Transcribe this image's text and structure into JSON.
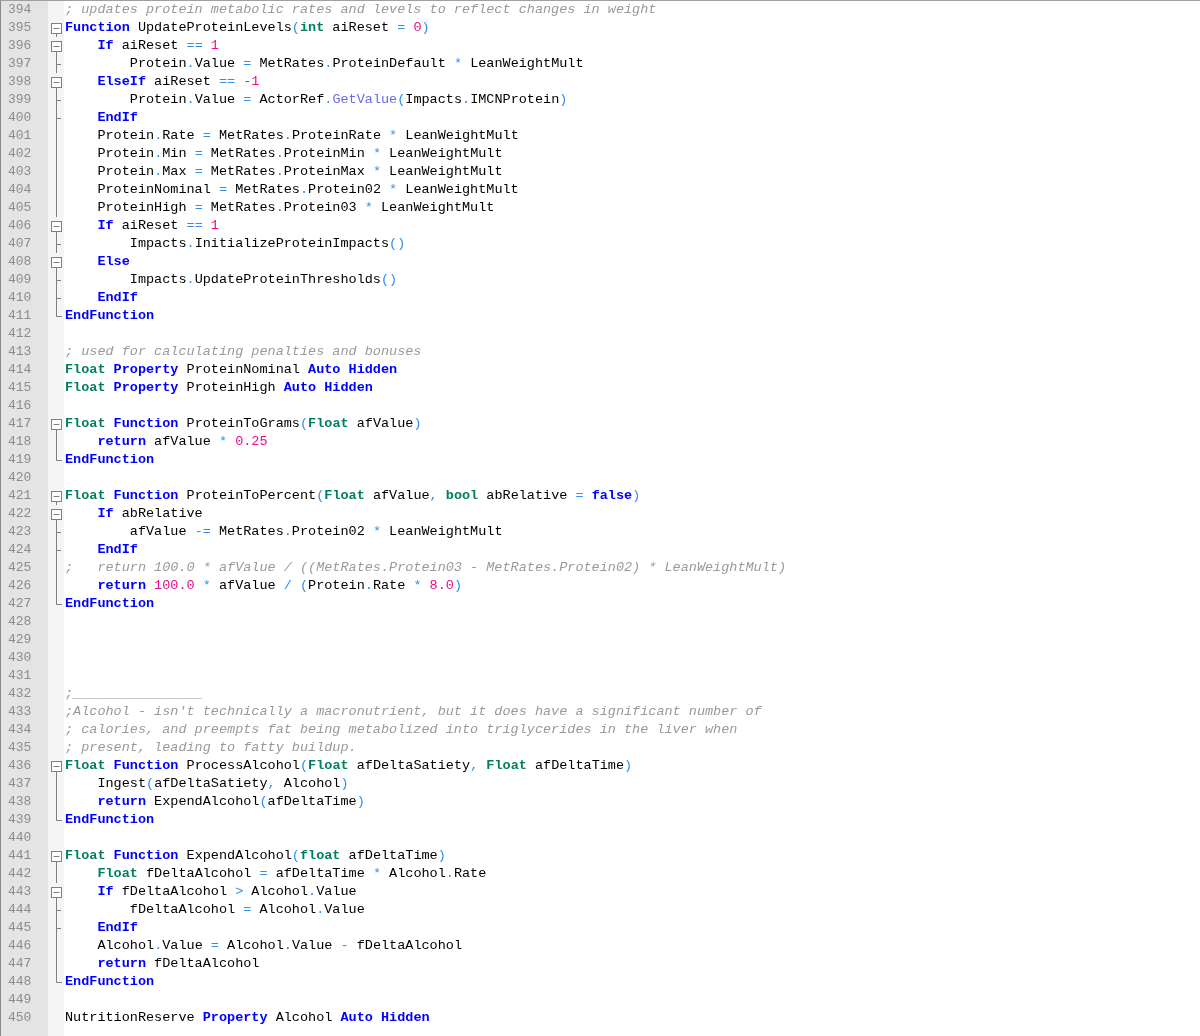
{
  "editor": {
    "lines": [
      {
        "number": "394",
        "kind": "none",
        "tokens": [
          {
            "kind": "c",
            "text": "; updates protein metabolic rates and levels to reflect changes in weight"
          }
        ]
      },
      {
        "number": "395",
        "kind": "open",
        "tokens": [
          {
            "kind": "k",
            "text": "Function"
          },
          {
            "kind": "p",
            "text": " UpdateProteinLevels"
          },
          {
            "kind": "o",
            "text": "("
          },
          {
            "kind": "t",
            "text": "int"
          },
          {
            "kind": "p",
            "text": " aiReset "
          },
          {
            "kind": "o",
            "text": "="
          },
          {
            "kind": "n",
            "text": " 0"
          },
          {
            "kind": "o",
            "text": ")"
          }
        ]
      },
      {
        "number": "396",
        "kind": "open",
        "tokens": [
          {
            "kind": "k",
            "text": "    If"
          },
          {
            "kind": "p",
            "text": " aiReset "
          },
          {
            "kind": "o",
            "text": "=="
          },
          {
            "kind": "n",
            "text": " 1"
          }
        ]
      },
      {
        "number": "397",
        "kind": "branch",
        "tokens": [
          {
            "kind": "p",
            "text": "        Protein"
          },
          {
            "kind": "o",
            "text": "."
          },
          {
            "kind": "p",
            "text": "Value "
          },
          {
            "kind": "o",
            "text": "="
          },
          {
            "kind": "p",
            "text": " MetRates"
          },
          {
            "kind": "o",
            "text": "."
          },
          {
            "kind": "p",
            "text": "ProteinDefault "
          },
          {
            "kind": "o",
            "text": "*"
          },
          {
            "kind": "p",
            "text": " LeanWeightMult"
          }
        ]
      },
      {
        "number": "398",
        "kind": "open",
        "tokens": [
          {
            "kind": "k",
            "text": "    ElseIf"
          },
          {
            "kind": "p",
            "text": " aiReset "
          },
          {
            "kind": "o",
            "text": "=="
          },
          {
            "kind": "n",
            "text": " -1"
          }
        ]
      },
      {
        "number": "399",
        "kind": "branch",
        "tokens": [
          {
            "kind": "p",
            "text": "        Protein"
          },
          {
            "kind": "o",
            "text": "."
          },
          {
            "kind": "p",
            "text": "Value "
          },
          {
            "kind": "o",
            "text": "="
          },
          {
            "kind": "p",
            "text": " ActorRef"
          },
          {
            "kind": "o",
            "text": "."
          },
          {
            "kind": "f",
            "text": "GetValue"
          },
          {
            "kind": "o",
            "text": "("
          },
          {
            "kind": "p",
            "text": "Impacts"
          },
          {
            "kind": "o",
            "text": "."
          },
          {
            "kind": "p",
            "text": "IMCNProtein"
          },
          {
            "kind": "o",
            "text": ")"
          }
        ]
      },
      {
        "number": "400",
        "kind": "branch",
        "tokens": [
          {
            "kind": "k",
            "text": "    EndIf"
          }
        ]
      },
      {
        "number": "401",
        "kind": "line",
        "tokens": [
          {
            "kind": "p",
            "text": "    Protein"
          },
          {
            "kind": "o",
            "text": "."
          },
          {
            "kind": "p",
            "text": "Rate "
          },
          {
            "kind": "o",
            "text": "="
          },
          {
            "kind": "p",
            "text": " MetRates"
          },
          {
            "kind": "o",
            "text": "."
          },
          {
            "kind": "p",
            "text": "ProteinRate "
          },
          {
            "kind": "o",
            "text": "*"
          },
          {
            "kind": "p",
            "text": " LeanWeightMult"
          }
        ]
      },
      {
        "number": "402",
        "kind": "line",
        "tokens": [
          {
            "kind": "p",
            "text": "    Protein"
          },
          {
            "kind": "o",
            "text": "."
          },
          {
            "kind": "p",
            "text": "Min "
          },
          {
            "kind": "o",
            "text": "="
          },
          {
            "kind": "p",
            "text": " MetRates"
          },
          {
            "kind": "o",
            "text": "."
          },
          {
            "kind": "p",
            "text": "ProteinMin "
          },
          {
            "kind": "o",
            "text": "*"
          },
          {
            "kind": "p",
            "text": " LeanWeightMult"
          }
        ]
      },
      {
        "number": "403",
        "kind": "line",
        "tokens": [
          {
            "kind": "p",
            "text": "    Protein"
          },
          {
            "kind": "o",
            "text": "."
          },
          {
            "kind": "p",
            "text": "Max "
          },
          {
            "kind": "o",
            "text": "="
          },
          {
            "kind": "p",
            "text": " MetRates"
          },
          {
            "kind": "o",
            "text": "."
          },
          {
            "kind": "p",
            "text": "ProteinMax "
          },
          {
            "kind": "o",
            "text": "*"
          },
          {
            "kind": "p",
            "text": " LeanWeightMult"
          }
        ]
      },
      {
        "number": "404",
        "kind": "line",
        "tokens": [
          {
            "kind": "p",
            "text": "    ProteinNominal "
          },
          {
            "kind": "o",
            "text": "="
          },
          {
            "kind": "p",
            "text": " MetRates"
          },
          {
            "kind": "o",
            "text": "."
          },
          {
            "kind": "p",
            "text": "Protein02 "
          },
          {
            "kind": "o",
            "text": "*"
          },
          {
            "kind": "p",
            "text": " LeanWeightMult"
          }
        ]
      },
      {
        "number": "405",
        "kind": "line",
        "tokens": [
          {
            "kind": "p",
            "text": "    ProteinHigh "
          },
          {
            "kind": "o",
            "text": "="
          },
          {
            "kind": "p",
            "text": " MetRates"
          },
          {
            "kind": "o",
            "text": "."
          },
          {
            "kind": "p",
            "text": "Protein03 "
          },
          {
            "kind": "o",
            "text": "*"
          },
          {
            "kind": "p",
            "text": " LeanWeightMult"
          }
        ]
      },
      {
        "number": "406",
        "kind": "open",
        "tokens": [
          {
            "kind": "k",
            "text": "    If"
          },
          {
            "kind": "p",
            "text": " aiReset "
          },
          {
            "kind": "o",
            "text": "=="
          },
          {
            "kind": "n",
            "text": " 1"
          }
        ]
      },
      {
        "number": "407",
        "kind": "branch",
        "tokens": [
          {
            "kind": "p",
            "text": "        Impacts"
          },
          {
            "kind": "o",
            "text": "."
          },
          {
            "kind": "p",
            "text": "InitializeProteinImpacts"
          },
          {
            "kind": "o",
            "text": "()"
          }
        ]
      },
      {
        "number": "408",
        "kind": "open",
        "tokens": [
          {
            "kind": "k",
            "text": "    Else"
          }
        ]
      },
      {
        "number": "409",
        "kind": "branch",
        "tokens": [
          {
            "kind": "p",
            "text": "        Impacts"
          },
          {
            "kind": "o",
            "text": "."
          },
          {
            "kind": "p",
            "text": "UpdateProteinThresholds"
          },
          {
            "kind": "o",
            "text": "()"
          }
        ]
      },
      {
        "number": "410",
        "kind": "branch",
        "tokens": [
          {
            "kind": "k",
            "text": "    EndIf"
          }
        ]
      },
      {
        "number": "411",
        "kind": "end",
        "tokens": [
          {
            "kind": "k",
            "text": "EndFunction"
          }
        ]
      },
      {
        "number": "412",
        "kind": "none"
      },
      {
        "number": "413",
        "kind": "none",
        "tokens": [
          {
            "kind": "c",
            "text": "; used for calculating penalties and bonuses"
          }
        ]
      },
      {
        "number": "414",
        "kind": "none",
        "tokens": [
          {
            "kind": "t",
            "text": "Float"
          },
          {
            "kind": "k",
            "text": " Property"
          },
          {
            "kind": "p",
            "text": " ProteinNominal "
          },
          {
            "kind": "k",
            "text": "Auto"
          },
          {
            "kind": "k",
            "text": " Hidden"
          }
        ]
      },
      {
        "number": "415",
        "kind": "none",
        "tokens": [
          {
            "kind": "t",
            "text": "Float"
          },
          {
            "kind": "k",
            "text": " Property"
          },
          {
            "kind": "p",
            "text": " ProteinHigh "
          },
          {
            "kind": "k",
            "text": "Auto"
          },
          {
            "kind": "k",
            "text": " Hidden"
          }
        ]
      },
      {
        "number": "416",
        "kind": "none"
      },
      {
        "number": "417",
        "kind": "open",
        "tokens": [
          {
            "kind": "t",
            "text": "Float"
          },
          {
            "kind": "k",
            "text": " Function"
          },
          {
            "kind": "p",
            "text": " ProteinToGrams"
          },
          {
            "kind": "o",
            "text": "("
          },
          {
            "kind": "t",
            "text": "Float"
          },
          {
            "kind": "p",
            "text": " afValue"
          },
          {
            "kind": "o",
            "text": ")"
          }
        ]
      },
      {
        "number": "418",
        "kind": "line",
        "tokens": [
          {
            "kind": "k",
            "text": "    return"
          },
          {
            "kind": "p",
            "text": " afValue "
          },
          {
            "kind": "o",
            "text": "*"
          },
          {
            "kind": "n",
            "text": " 0.25"
          }
        ]
      },
      {
        "number": "419",
        "kind": "end",
        "tokens": [
          {
            "kind": "k",
            "text": "EndFunction"
          }
        ]
      },
      {
        "number": "420",
        "kind": "none"
      },
      {
        "number": "421",
        "kind": "open",
        "tokens": [
          {
            "kind": "t",
            "text": "Float"
          },
          {
            "kind": "k",
            "text": " Function"
          },
          {
            "kind": "p",
            "text": " ProteinToPercent"
          },
          {
            "kind": "o",
            "text": "("
          },
          {
            "kind": "t",
            "text": "Float"
          },
          {
            "kind": "p",
            "text": " afValue"
          },
          {
            "kind": "o",
            "text": ","
          },
          {
            "kind": "t",
            "text": " bool"
          },
          {
            "kind": "p",
            "text": " abRelative "
          },
          {
            "kind": "o",
            "text": "="
          },
          {
            "kind": "k",
            "text": " false"
          },
          {
            "kind": "o",
            "text": ")"
          }
        ]
      },
      {
        "number": "422",
        "kind": "open",
        "tokens": [
          {
            "kind": "k",
            "text": "    If"
          },
          {
            "kind": "p",
            "text": " abRelative"
          }
        ]
      },
      {
        "number": "423",
        "kind": "branch",
        "tokens": [
          {
            "kind": "p",
            "text": "        afValue "
          },
          {
            "kind": "o",
            "text": "-="
          },
          {
            "kind": "p",
            "text": " MetRates"
          },
          {
            "kind": "o",
            "text": "."
          },
          {
            "kind": "p",
            "text": "Protein02 "
          },
          {
            "kind": "o",
            "text": "*"
          },
          {
            "kind": "p",
            "text": " LeanWeightMult"
          }
        ]
      },
      {
        "number": "424",
        "kind": "branch",
        "tokens": [
          {
            "kind": "k",
            "text": "    EndIf"
          }
        ]
      },
      {
        "number": "425",
        "kind": "line",
        "tokens": [
          {
            "kind": "c",
            "text": ";   return 100.0 * afValue / ((MetRates.Protein03 - MetRates.Protein02) * LeanWeightMult)"
          }
        ]
      },
      {
        "number": "426",
        "kind": "line",
        "tokens": [
          {
            "kind": "k",
            "text": "    return"
          },
          {
            "kind": "n",
            "text": " 100.0"
          },
          {
            "kind": "o",
            "text": " *"
          },
          {
            "kind": "p",
            "text": " afValue "
          },
          {
            "kind": "o",
            "text": "/ ("
          },
          {
            "kind": "p",
            "text": "Protein"
          },
          {
            "kind": "o",
            "text": "."
          },
          {
            "kind": "p",
            "text": "Rate "
          },
          {
            "kind": "o",
            "text": "*"
          },
          {
            "kind": "n",
            "text": " 8.0"
          },
          {
            "kind": "o",
            "text": ")"
          }
        ]
      },
      {
        "number": "427",
        "kind": "end",
        "tokens": [
          {
            "kind": "k",
            "text": "EndFunction"
          }
        ]
      },
      {
        "number": "428",
        "kind": "none"
      },
      {
        "number": "429",
        "kind": "none"
      },
      {
        "number": "430",
        "kind": "none"
      },
      {
        "number": "431",
        "kind": "none"
      },
      {
        "number": "432",
        "kind": "none",
        "tokens": [
          {
            "kind": "c",
            "text": ";________________"
          }
        ]
      },
      {
        "number": "433",
        "kind": "none",
        "tokens": [
          {
            "kind": "c",
            "text": ";Alcohol - isn't technically a macronutrient, but it does have a significant number of"
          }
        ]
      },
      {
        "number": "434",
        "kind": "none",
        "tokens": [
          {
            "kind": "c",
            "text": "; calories, and preempts fat being metabolized into triglycerides in the liver when"
          }
        ]
      },
      {
        "number": "435",
        "kind": "none",
        "tokens": [
          {
            "kind": "c",
            "text": "; present, leading to fatty buildup."
          }
        ]
      },
      {
        "number": "436",
        "kind": "open",
        "tokens": [
          {
            "kind": "t",
            "text": "Float"
          },
          {
            "kind": "k",
            "text": " Function"
          },
          {
            "kind": "p",
            "text": " ProcessAlcohol"
          },
          {
            "kind": "o",
            "text": "("
          },
          {
            "kind": "t",
            "text": "Float"
          },
          {
            "kind": "p",
            "text": " afDeltaSatiety"
          },
          {
            "kind": "o",
            "text": ","
          },
          {
            "kind": "t",
            "text": " Float"
          },
          {
            "kind": "p",
            "text": " afDeltaTime"
          },
          {
            "kind": "o",
            "text": ")"
          }
        ]
      },
      {
        "number": "437",
        "kind": "line",
        "tokens": [
          {
            "kind": "p",
            "text": "    Ingest"
          },
          {
            "kind": "o",
            "text": "("
          },
          {
            "kind": "p",
            "text": "afDeltaSatiety"
          },
          {
            "kind": "o",
            "text": ","
          },
          {
            "kind": "p",
            "text": " Alcohol"
          },
          {
            "kind": "o",
            "text": ")"
          }
        ]
      },
      {
        "number": "438",
        "kind": "line",
        "tokens": [
          {
            "kind": "k",
            "text": "    return"
          },
          {
            "kind": "p",
            "text": " ExpendAlcohol"
          },
          {
            "kind": "o",
            "text": "("
          },
          {
            "kind": "p",
            "text": "afDeltaTime"
          },
          {
            "kind": "o",
            "text": ")"
          }
        ]
      },
      {
        "number": "439",
        "kind": "end",
        "tokens": [
          {
            "kind": "k",
            "text": "EndFunction"
          }
        ]
      },
      {
        "number": "440",
        "kind": "none"
      },
      {
        "number": "441",
        "kind": "open",
        "tokens": [
          {
            "kind": "t",
            "text": "Float"
          },
          {
            "kind": "k",
            "text": " Function"
          },
          {
            "kind": "p",
            "text": " ExpendAlcohol"
          },
          {
            "kind": "o",
            "text": "("
          },
          {
            "kind": "t",
            "text": "float"
          },
          {
            "kind": "p",
            "text": " afDeltaTime"
          },
          {
            "kind": "o",
            "text": ")"
          }
        ]
      },
      {
        "number": "442",
        "kind": "line",
        "tokens": [
          {
            "kind": "t",
            "text": "    Float"
          },
          {
            "kind": "p",
            "text": " fDeltaAlcohol "
          },
          {
            "kind": "o",
            "text": "="
          },
          {
            "kind": "p",
            "text": " afDeltaTime "
          },
          {
            "kind": "o",
            "text": "*"
          },
          {
            "kind": "p",
            "text": " Alcohol"
          },
          {
            "kind": "o",
            "text": "."
          },
          {
            "kind": "p",
            "text": "Rate"
          }
        ]
      },
      {
        "number": "443",
        "kind": "open",
        "tokens": [
          {
            "kind": "k",
            "text": "    If"
          },
          {
            "kind": "p",
            "text": " fDeltaAlcohol "
          },
          {
            "kind": "o",
            "text": ">"
          },
          {
            "kind": "p",
            "text": " Alcohol"
          },
          {
            "kind": "o",
            "text": "."
          },
          {
            "kind": "p",
            "text": "Value"
          }
        ]
      },
      {
        "number": "444",
        "kind": "branch",
        "tokens": [
          {
            "kind": "p",
            "text": "        fDeltaAlcohol "
          },
          {
            "kind": "o",
            "text": "="
          },
          {
            "kind": "p",
            "text": " Alcohol"
          },
          {
            "kind": "o",
            "text": "."
          },
          {
            "kind": "p",
            "text": "Value"
          }
        ]
      },
      {
        "number": "445",
        "kind": "branch",
        "tokens": [
          {
            "kind": "k",
            "text": "    EndIf"
          }
        ]
      },
      {
        "number": "446",
        "kind": "line",
        "tokens": [
          {
            "kind": "p",
            "text": "    Alcohol"
          },
          {
            "kind": "o",
            "text": "."
          },
          {
            "kind": "p",
            "text": "Value "
          },
          {
            "kind": "o",
            "text": "="
          },
          {
            "kind": "p",
            "text": " Alcohol"
          },
          {
            "kind": "o",
            "text": "."
          },
          {
            "kind": "p",
            "text": "Value "
          },
          {
            "kind": "o",
            "text": "-"
          },
          {
            "kind": "p",
            "text": " fDeltaAlcohol"
          }
        ]
      },
      {
        "number": "447",
        "kind": "line",
        "tokens": [
          {
            "kind": "k",
            "text": "    return"
          },
          {
            "kind": "p",
            "text": " fDeltaAlcohol"
          }
        ]
      },
      {
        "number": "448",
        "kind": "end",
        "tokens": [
          {
            "kind": "k",
            "text": "EndFunction"
          }
        ]
      },
      {
        "number": "449",
        "kind": "none"
      },
      {
        "number": "450",
        "kind": "none",
        "tokens": [
          {
            "kind": "p",
            "text": "NutritionReserve "
          },
          {
            "kind": "k",
            "text": "Property"
          },
          {
            "kind": "p",
            "text": " Alcohol "
          },
          {
            "kind": "k",
            "text": "Auto"
          },
          {
            "kind": "k",
            "text": " Hidden"
          }
        ]
      }
    ]
  }
}
